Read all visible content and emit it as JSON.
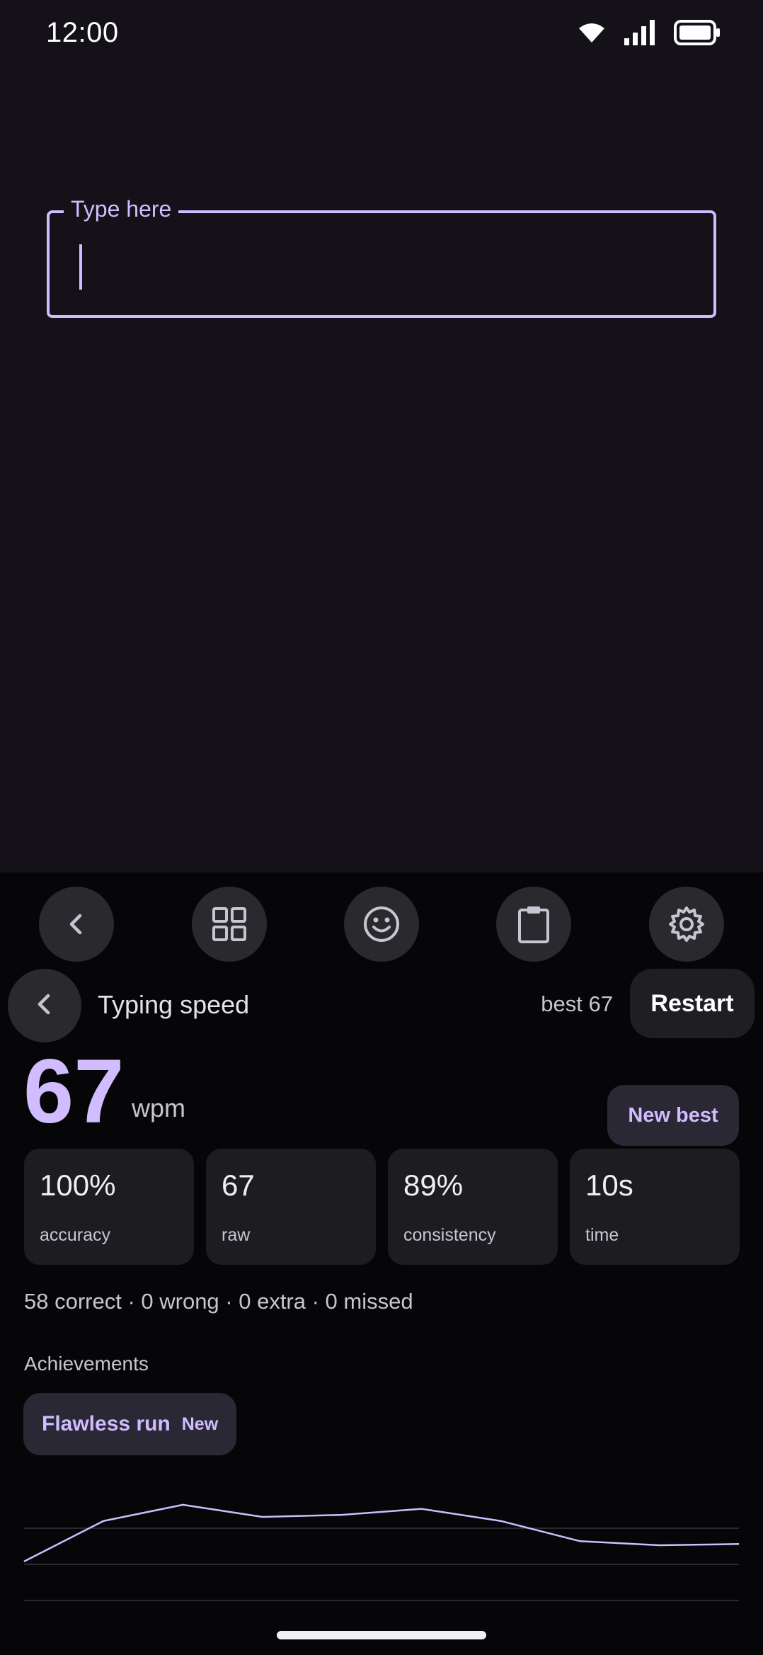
{
  "status_bar": {
    "time": "12:00",
    "icons": [
      "wifi-icon",
      "signal-icon",
      "battery-icon"
    ]
  },
  "input": {
    "label": "Type here",
    "value": "",
    "placeholder": ""
  },
  "toolbar": {
    "buttons": [
      "chevron-left-icon",
      "grid-icon",
      "emoji-icon",
      "clipboard-icon",
      "gear-icon"
    ]
  },
  "header": {
    "title": "Typing speed",
    "best": "best 67",
    "restart_label": "Restart"
  },
  "result": {
    "wpm": "67",
    "unit": "wpm",
    "badge": "New best"
  },
  "stats": [
    {
      "value": "100%",
      "label": "accuracy"
    },
    {
      "value": "67",
      "label": "raw"
    },
    {
      "value": "89%",
      "label": "consistency"
    },
    {
      "value": "10s",
      "label": "time"
    }
  ],
  "summary": "58 correct · 0 wrong · 0 extra · 0 missed",
  "achievements": {
    "title": "Achievements",
    "items": [
      {
        "name": "Flawless run",
        "tag": "New"
      }
    ]
  },
  "chart_data": {
    "type": "line",
    "values": [
      50,
      60,
      64,
      61,
      61.5,
      63,
      60,
      55,
      54,
      54.3
    ],
    "ylim": [
      40,
      75
    ]
  },
  "colors": {
    "accent": "#d0bcff",
    "background": "#141218",
    "panel": "#060608"
  }
}
